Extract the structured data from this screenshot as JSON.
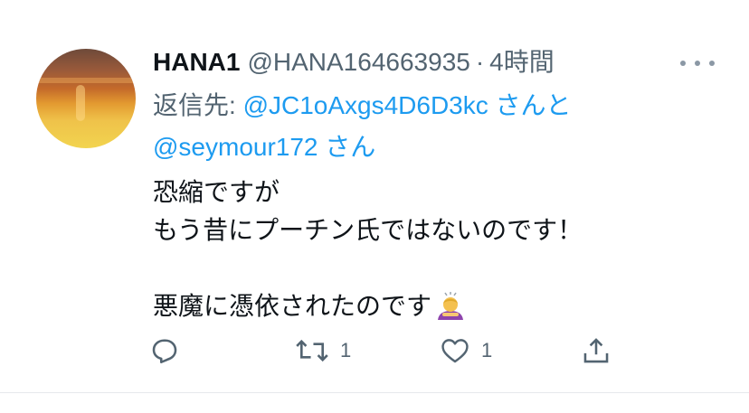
{
  "tweet": {
    "display_name": "HANA1",
    "handle": "@HANA164663935",
    "separator": "·",
    "time": "4時間",
    "reply_prefix": "返信先: ",
    "reply_mention_1": "@JC1oAxgs4D6D3kc",
    "reply_joiner": " さんと",
    "reply_mention_2": "@seymour172",
    "reply_suffix": " さん",
    "body_line_1": "恐縮ですが",
    "body_line_2": "もう昔にプーチン氏ではないのです！",
    "body_line_3": "悪魔に憑依されたのです",
    "emoji_name": "person-bowing-emoji"
  },
  "actions": {
    "reply_icon": "reply-icon",
    "retweet_icon": "retweet-icon",
    "retweet_count": "1",
    "like_icon": "heart-icon",
    "like_count": "1",
    "share_icon": "share-icon"
  },
  "colors": {
    "text": "#0f1419",
    "secondary": "#536471",
    "link": "#1d9bf0"
  }
}
